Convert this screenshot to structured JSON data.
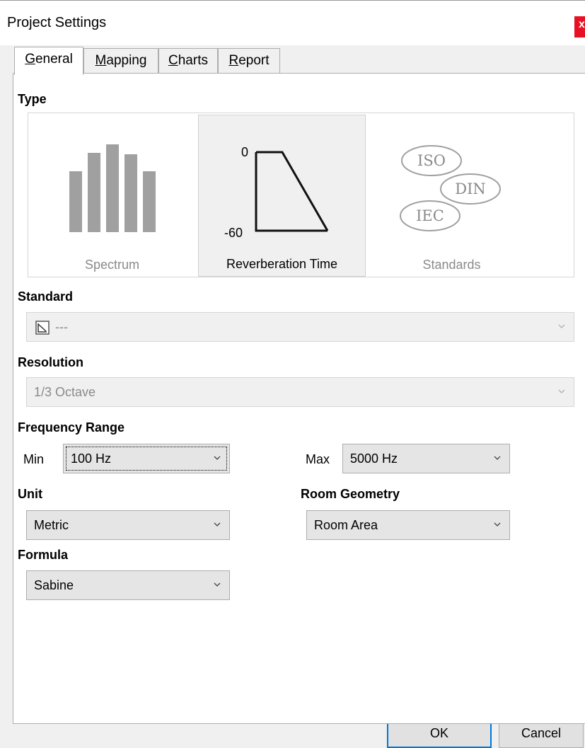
{
  "window": {
    "title": "Project Settings",
    "close_glyph": "x"
  },
  "tabs": [
    {
      "label": "General",
      "mnemonic": "G",
      "rest": "eneral",
      "active": true
    },
    {
      "label": "Mapping",
      "mnemonic": "M",
      "rest": "apping",
      "active": false
    },
    {
      "label": "Charts",
      "mnemonic": "C",
      "rest": "harts",
      "active": false
    },
    {
      "label": "Report",
      "mnemonic": "R",
      "rest": "eport",
      "active": false
    }
  ],
  "type_section": {
    "heading": "Type",
    "options": [
      {
        "label": "Spectrum",
        "icon": "spectrum-bars-icon",
        "selected": false
      },
      {
        "label": "Reverberation Time",
        "icon": "decay-curve-icon",
        "selected": true,
        "axis_top": "0",
        "axis_bottom": "-60"
      },
      {
        "label": "Standards",
        "icon": "standards-bubbles-icon",
        "selected": false,
        "bubbles": [
          "ISO",
          "DIN",
          "IEC"
        ]
      }
    ]
  },
  "standard": {
    "heading": "Standard",
    "value": "---",
    "icon": "standard-curve-icon",
    "enabled": false
  },
  "resolution": {
    "heading": "Resolution",
    "value": "1/3 Octave",
    "enabled": false
  },
  "frequency_range": {
    "heading": "Frequency Range",
    "min_label": "Min",
    "min_value": "100 Hz",
    "max_label": "Max",
    "max_value": "5000 Hz"
  },
  "unit": {
    "heading": "Unit",
    "value": "Metric"
  },
  "room_geometry": {
    "heading": "Room Geometry",
    "value": "Room Area"
  },
  "formula": {
    "heading": "Formula",
    "value": "Sabine"
  },
  "buttons": {
    "ok": "OK",
    "cancel": "Cancel"
  },
  "colors": {
    "accent": "#0078d7",
    "close": "#e81123",
    "icon_gray": "#a0a0a0"
  }
}
